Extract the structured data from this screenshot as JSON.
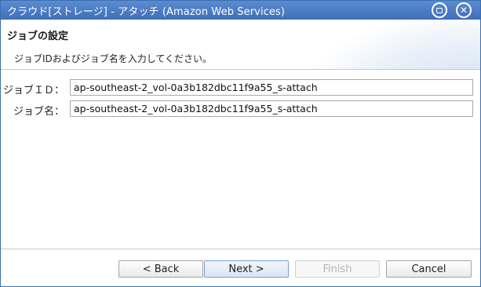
{
  "window": {
    "title": "クラウド[ストレージ] - アタッチ (Amazon Web Services)",
    "maximize_icon": "maximize-icon",
    "close_icon": "close-icon",
    "titlebar_color": "#4a7cc3"
  },
  "header": {
    "title": "ジョブの設定",
    "description": "ジョブIDおよびジョブ名を入力してください。"
  },
  "form": {
    "job_id": {
      "label": "ジョブＩＤ：",
      "value": "ap-southeast-2_vol-0a3b182dbc11f9a55_s-attach"
    },
    "job_name": {
      "label": "ジョブ名：",
      "value": "ap-southeast-2_vol-0a3b182dbc11f9a55_s-attach"
    }
  },
  "buttons": {
    "back": "< Back",
    "next": "Next >",
    "finish": "Finish",
    "cancel": "Cancel"
  }
}
